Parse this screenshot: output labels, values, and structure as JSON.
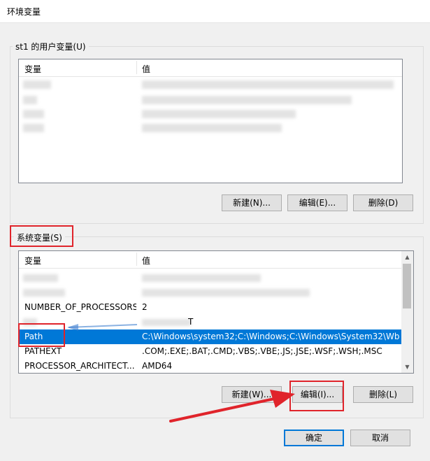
{
  "window": {
    "title": "环境变量"
  },
  "user_group": {
    "label": "st1 的用户变量(U)",
    "col_var": "变量",
    "col_val": "值",
    "buttons": {
      "new": "新建(N)...",
      "edit": "编辑(E)...",
      "delete": "删除(D)"
    }
  },
  "system_group": {
    "label": "系统变量(S)",
    "col_var": "变量",
    "col_val": "值",
    "rows": [
      {
        "name": "",
        "value": ""
      },
      {
        "name": "",
        "value": ""
      },
      {
        "name": "NUMBER_OF_PROCESSORS",
        "value": "2"
      },
      {
        "name": "",
        "value": "T"
      },
      {
        "name": "Path",
        "value": "C:\\Windows\\system32;C:\\Windows;C:\\Windows\\System32\\Wb..."
      },
      {
        "name": "PATHEXT",
        "value": ".COM;.EXE;.BAT;.CMD;.VBS;.VBE;.JS;.JSE;.WSF;.WSH;.MSC"
      },
      {
        "name": "PROCESSOR_ARCHITECT...",
        "value": "AMD64"
      }
    ],
    "buttons": {
      "new": "新建(W)...",
      "edit": "编辑(I)...",
      "delete": "删除(L)"
    }
  },
  "footer": {
    "ok": "确定",
    "cancel": "取消"
  },
  "colors": {
    "selection": "#0078d7",
    "annotation": "#e0242b"
  }
}
